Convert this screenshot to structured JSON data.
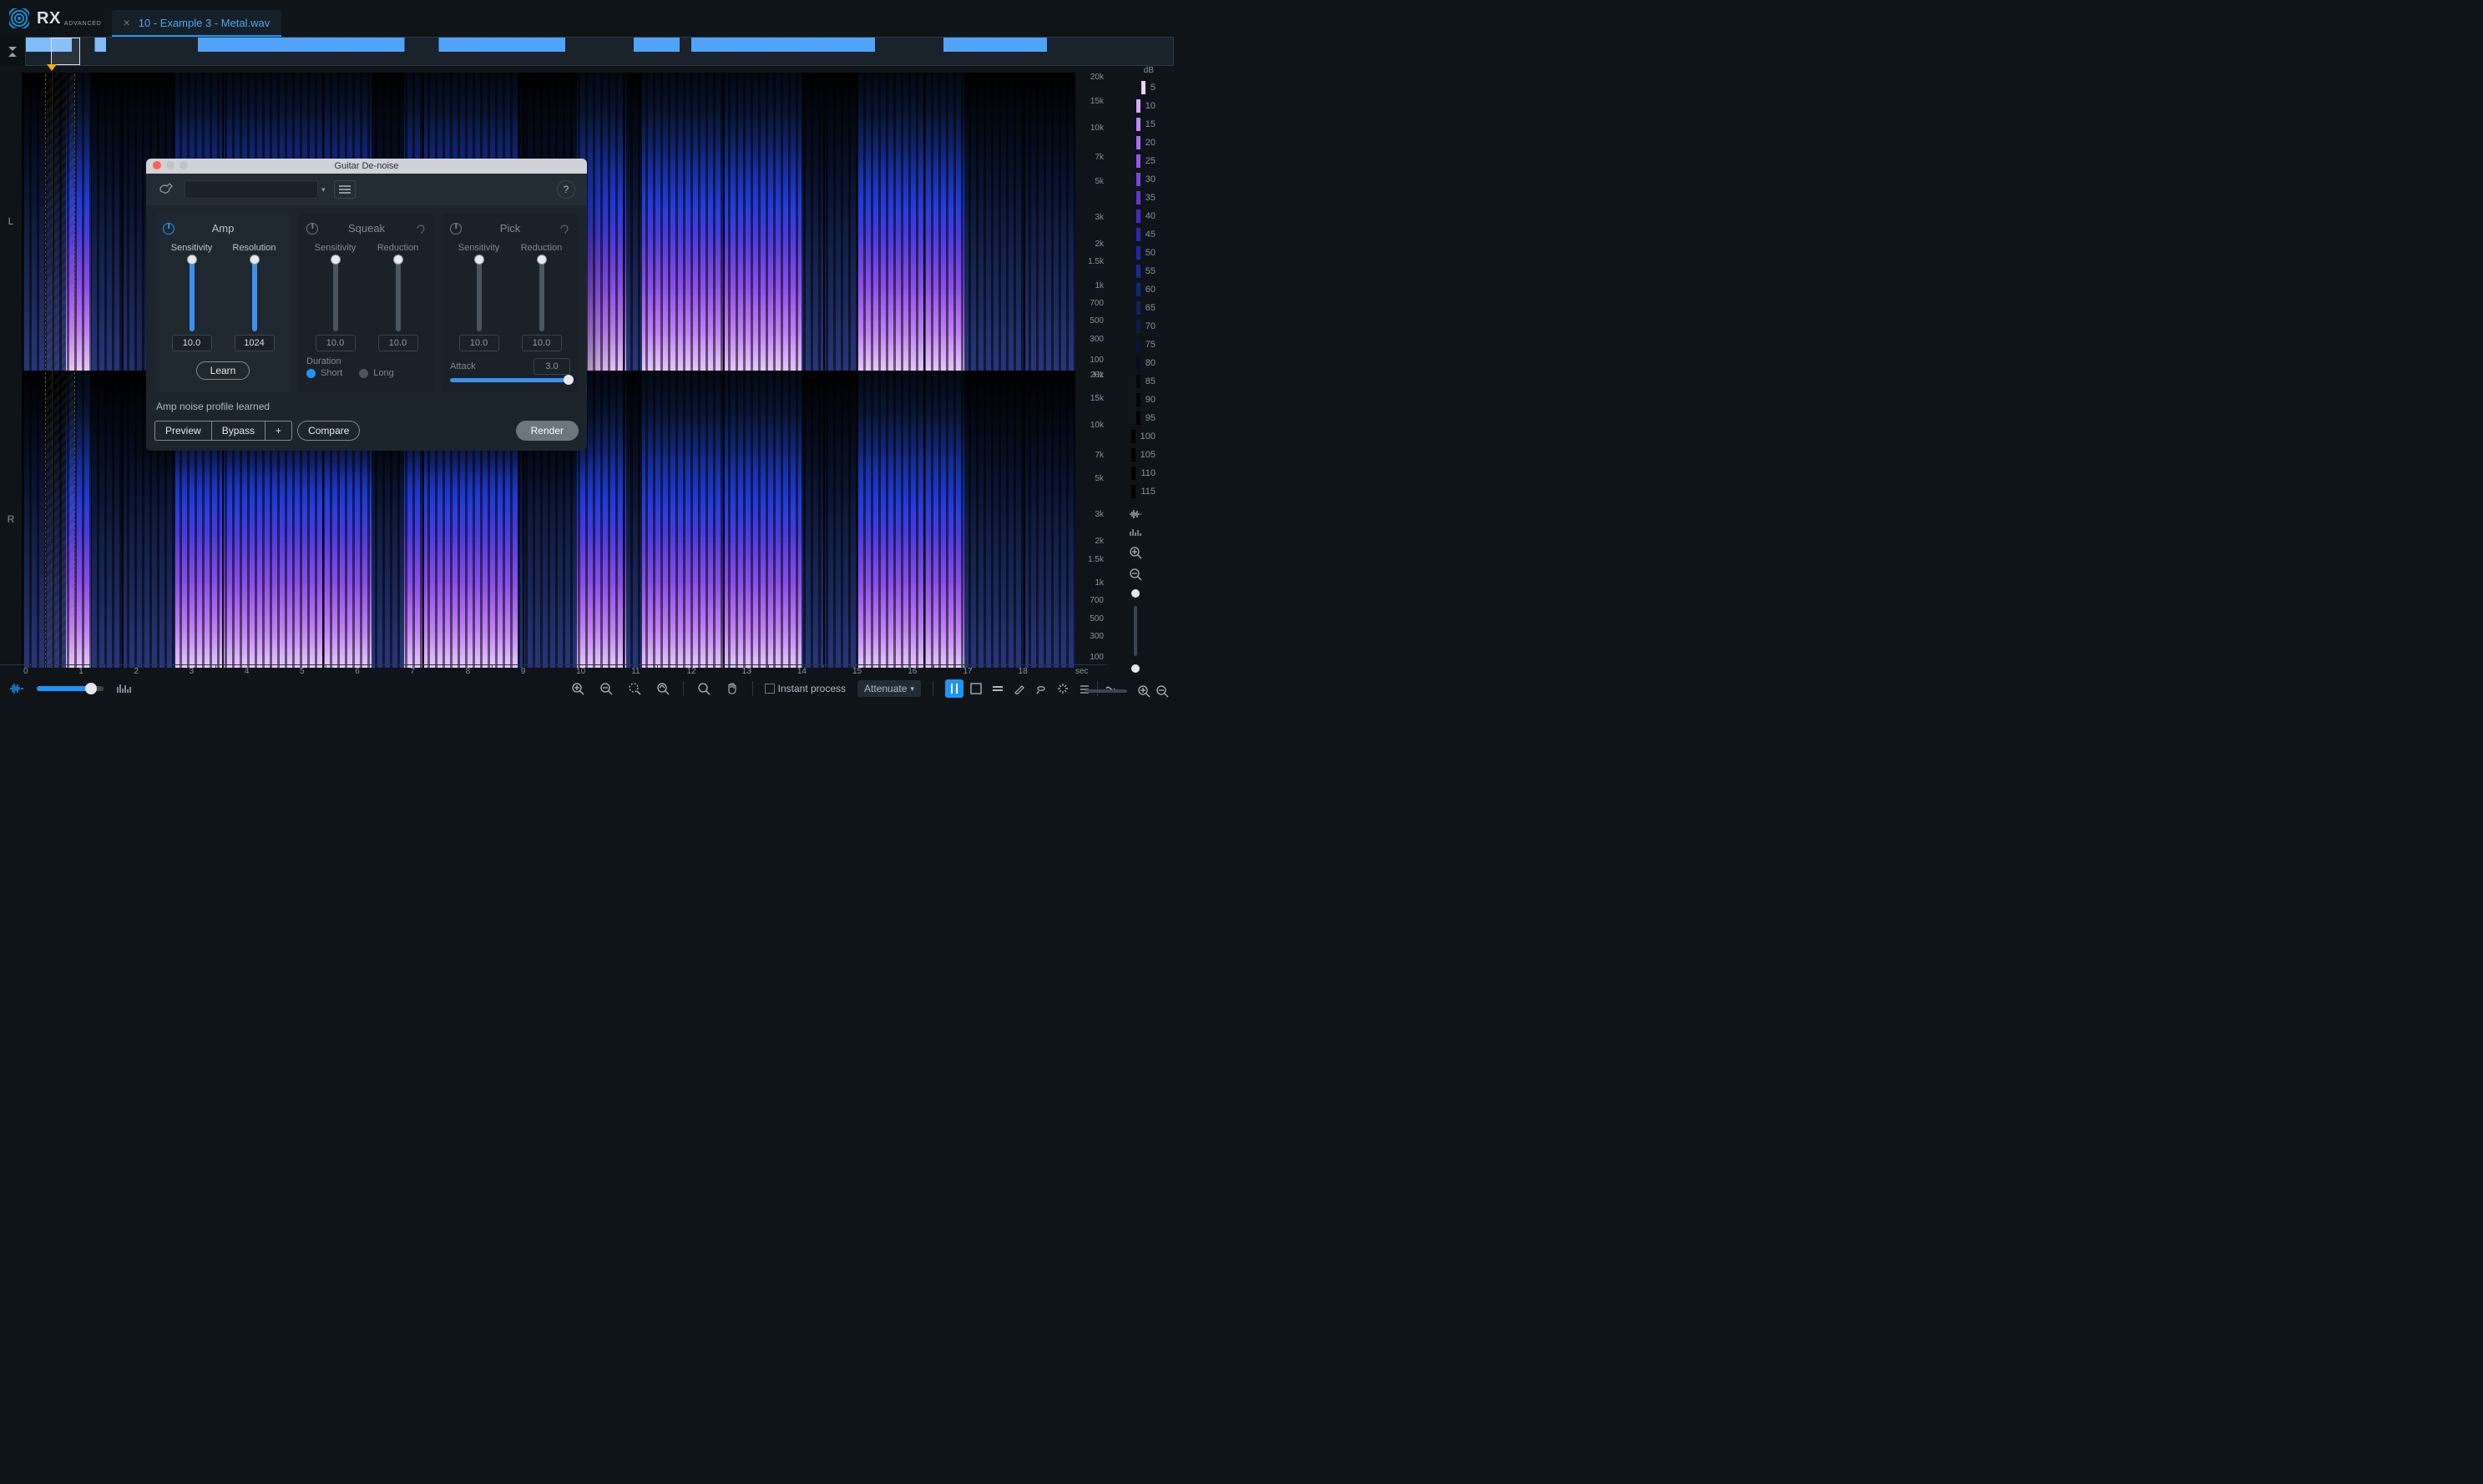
{
  "app": {
    "brand": "RX",
    "edition": "ADVANCED",
    "file_tab": "10 - Example 3 - Metal.wav"
  },
  "spectro": {
    "channels": [
      "L",
      "R"
    ],
    "freq_ticks": [
      "20k",
      "15k",
      "10k",
      "7k",
      "5k",
      "3k",
      "2k",
      "1.5k",
      "1k",
      "700",
      "500",
      "300",
      "100"
    ],
    "freq_unit": "Hz",
    "time_ticks": [
      "0",
      "1",
      "2",
      "3",
      "4",
      "5",
      "6",
      "7",
      "8",
      "9",
      "10",
      "11",
      "12",
      "13",
      "14",
      "15",
      "16",
      "17",
      "18"
    ],
    "time_unit": "sec"
  },
  "db_rail": {
    "unit": "dB",
    "ticks": [
      "5",
      "10",
      "15",
      "20",
      "25",
      "30",
      "35",
      "40",
      "45",
      "50",
      "55",
      "60",
      "65",
      "70",
      "75",
      "80",
      "85",
      "90",
      "95",
      "100",
      "105",
      "110",
      "115"
    ],
    "colors": [
      "#efd1ff",
      "#d2a9fa",
      "#bc8af3",
      "#a86fec",
      "#9258e5",
      "#7a46dd",
      "#6037d2",
      "#432cc5",
      "#2b26b5",
      "#2128a4",
      "#1a2b94",
      "#122677",
      "#0f2162",
      "#0b1a4d",
      "#081439",
      "#050d26",
      "#030815",
      "#01040c",
      "#000000",
      "#000000",
      "#000000",
      "#000000",
      "#000000"
    ]
  },
  "plugin": {
    "title": "Guitar De-noise",
    "amp": {
      "title": "Amp",
      "sens_label": "Sensitivity",
      "res_label": "Resolution",
      "sens_value": "10.0",
      "res_value": "1024",
      "learn": "Learn"
    },
    "squeak": {
      "title": "Squeak",
      "sens_label": "Sensitivity",
      "red_label": "Reduction",
      "sens_value": "10.0",
      "red_value": "10.0",
      "duration_label": "Duration",
      "short": "Short",
      "long": "Long"
    },
    "pick": {
      "title": "Pick",
      "sens_label": "Sensitivity",
      "red_label": "Reduction",
      "sens_value": "10.0",
      "red_value": "10.0",
      "attack_label": "Attack",
      "attack_value": "3.0"
    },
    "status": "Amp noise profile learned",
    "buttons": {
      "preview": "Preview",
      "bypass": "Bypass",
      "plus": "+",
      "compare": "Compare",
      "render": "Render"
    }
  },
  "bottombar": {
    "instant_process": "Instant process",
    "attenuate": "Attenuate"
  }
}
